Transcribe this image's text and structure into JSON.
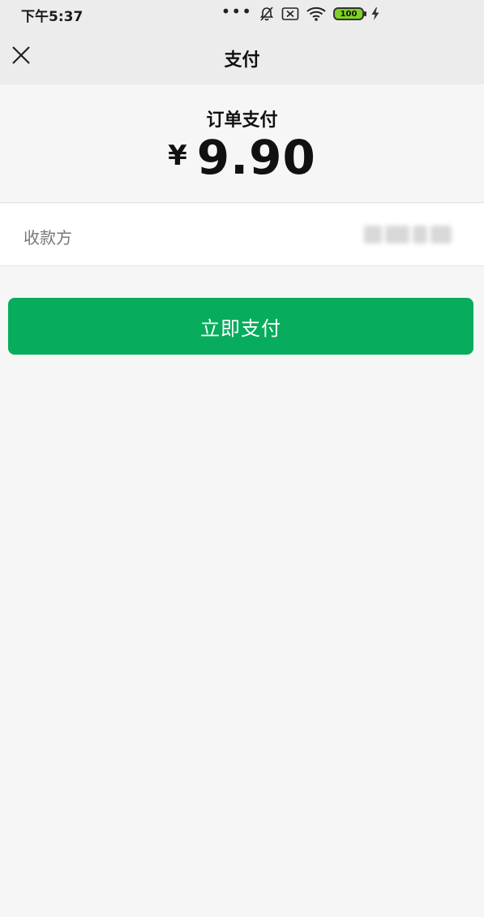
{
  "status_bar": {
    "time": "下午5:37",
    "battery_level": "100",
    "icons": [
      "more-dots-icon",
      "bell-muted-icon",
      "sim-off-icon",
      "wifi-icon",
      "battery-icon",
      "charging-bolt-icon"
    ]
  },
  "nav": {
    "title": "支付",
    "close_icon": "close-icon"
  },
  "payment": {
    "order_label": "订单支付",
    "currency_symbol": "¥",
    "amount": "9.90"
  },
  "payee": {
    "label": "收款方"
  },
  "actions": {
    "pay_now_label": "立即支付"
  },
  "colors": {
    "accent": "#07ad5d",
    "background": "#f6f6f7"
  }
}
